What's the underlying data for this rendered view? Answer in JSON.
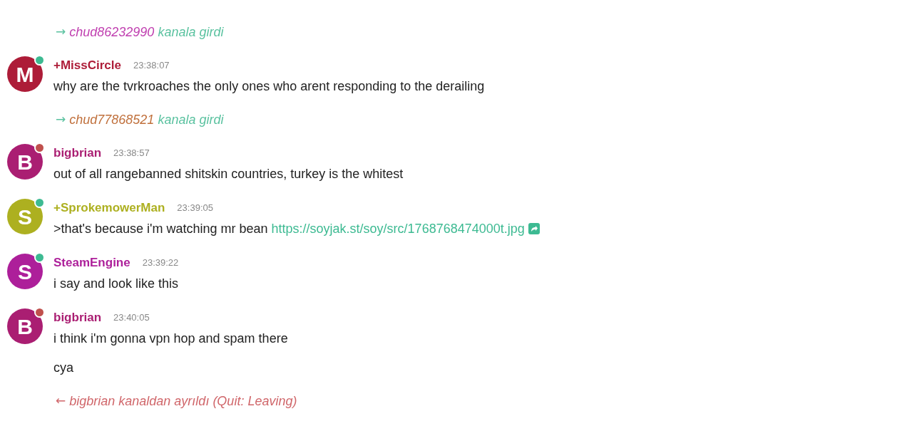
{
  "items": [
    {
      "kind": "join",
      "arrow": "→",
      "nick": "chud86232990",
      "color": "#c040b0",
      "text": "kanala girdi"
    },
    {
      "kind": "message",
      "letter": "M",
      "color": "#ad1c38",
      "away": false,
      "name": "+MissCircle",
      "time": "23:38:07",
      "lines": [
        {
          "text": "why are the tvrkroaches the only ones who arent responding to the derailing"
        }
      ]
    },
    {
      "kind": "join",
      "arrow": "→",
      "nick": "chud77868521",
      "color": "#c0703c",
      "text": "kanala girdi"
    },
    {
      "kind": "message",
      "letter": "B",
      "color": "#aa1e72",
      "away": true,
      "name": "bigbrian",
      "time": "23:38:57",
      "lines": [
        {
          "text": "out of all rangebanned shitskin countries, turkey is the whitest"
        }
      ]
    },
    {
      "kind": "message",
      "letter": "S",
      "color": "#adb020",
      "away": false,
      "name": "+SprokemowerMan",
      "time": "23:39:05",
      "lines": [
        {
          "text": ">that's because i'm watching mr bean",
          "link": "https://soyjak.st/soy/src/1768768474000t.jpg"
        }
      ]
    },
    {
      "kind": "message",
      "letter": "S",
      "color": "#ad1f9a",
      "away": false,
      "name": "SteamEngine",
      "time": "23:39:22",
      "lines": [
        {
          "text": "i say and look like this"
        }
      ]
    },
    {
      "kind": "message",
      "letter": "B",
      "color": "#aa1e72",
      "away": true,
      "name": "bigbrian",
      "time": "23:40:05",
      "lines": [
        {
          "text": "i think i'm gonna vpn hop and spam there"
        },
        {
          "text": "cya"
        }
      ]
    },
    {
      "kind": "quit",
      "arrow": "←",
      "nick": "bigbrian",
      "text": "kanaldan ayrıldı (Quit: Leaving)"
    }
  ]
}
